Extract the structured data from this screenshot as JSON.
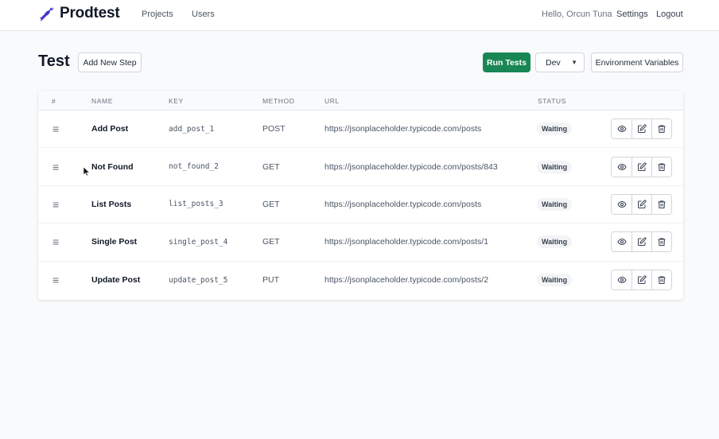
{
  "navbar": {
    "brand": "Prodtest",
    "links": [
      "Projects",
      "Users"
    ],
    "greeting": "Hello, Orcun Tuna",
    "settings": "Settings",
    "logout": "Logout",
    "brand_color": "#4338ca"
  },
  "page": {
    "title": "Test",
    "add_step_label": "Add New Step",
    "run_tests_label": "Run Tests",
    "environment_selected": "Dev",
    "env_vars_label": "Environment Variables"
  },
  "table": {
    "headers": [
      "#",
      "NAME",
      "KEY",
      "METHOD",
      "URL",
      "STATUS"
    ],
    "rows": [
      {
        "name": "Add Post",
        "key": "add_post_1",
        "method": "POST",
        "url": "https://jsonplaceholder.typicode.com/posts",
        "status": "Waiting"
      },
      {
        "name": "Not Found",
        "key": "not_found_2",
        "method": "GET",
        "url": "https://jsonplaceholder.typicode.com/posts/843",
        "status": "Waiting"
      },
      {
        "name": "List Posts",
        "key": "list_posts_3",
        "method": "GET",
        "url": "https://jsonplaceholder.typicode.com/posts",
        "status": "Waiting"
      },
      {
        "name": "Single Post",
        "key": "single_post_4",
        "method": "GET",
        "url": "https://jsonplaceholder.typicode.com/posts/1",
        "status": "Waiting"
      },
      {
        "name": "Update Post",
        "key": "update_post_5",
        "method": "PUT",
        "url": "https://jsonplaceholder.typicode.com/posts/2",
        "status": "Waiting"
      }
    ],
    "row_icons": {
      "drag": "drag-handle-icon",
      "view": "eye-icon",
      "edit": "edit-icon",
      "delete": "trash-icon"
    }
  },
  "colors": {
    "primary": "#198754",
    "brand": "#4338ca"
  }
}
